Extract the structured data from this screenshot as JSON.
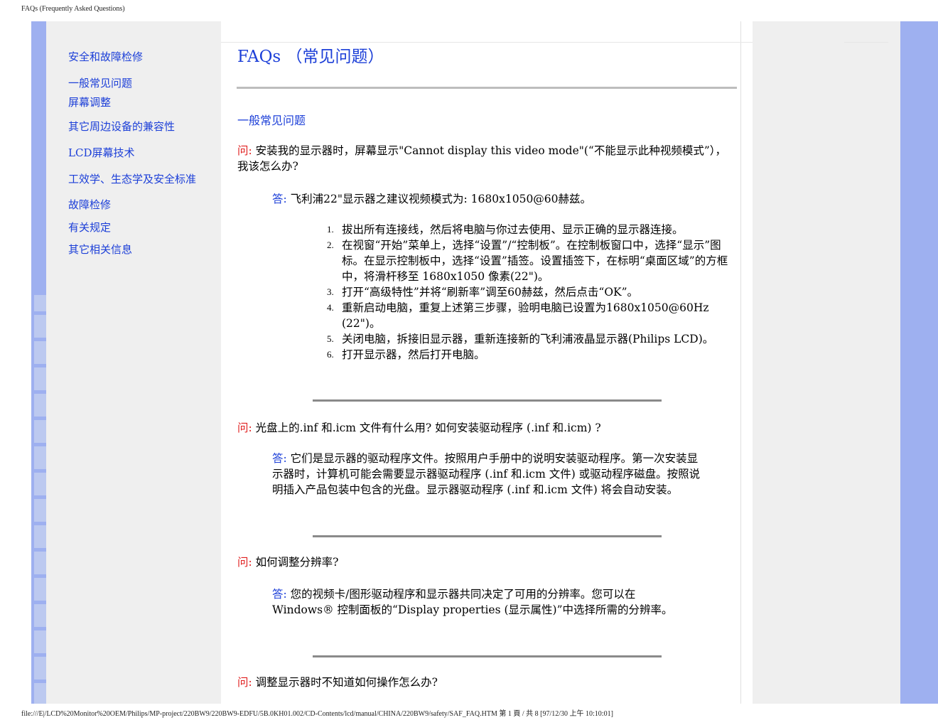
{
  "page_header": "FAQs (Frequently Asked Questions)",
  "page_footer": "file:///E|/LCD%20Monitor%20OEM/Philips/MP-project/220BW9/220BW9-EDFU/5B.0KH01.002/CD-Contents/lcd/manual/CHINA/220BW9/safety/SAF_FAQ.HTM 第 1 頁 / 共 8  [97/12/30 上午 10:10:01]",
  "sidebar": {
    "items": [
      {
        "label": "安全和故障检修"
      },
      {
        "label": "一般常见问题"
      },
      {
        "label": "屏幕调整"
      },
      {
        "label": "其它周边设备的兼容性"
      },
      {
        "label": "LCD屏幕技术"
      },
      {
        "label": "工效学、生态学及安全标准"
      },
      {
        "label": "故障检修"
      },
      {
        "label": "有关规定"
      },
      {
        "label": "其它相关信息"
      }
    ]
  },
  "main": {
    "title": "FAQs （常见问题）",
    "section_title": "一般常见问题",
    "q_label": "问:",
    "a_label": "答:",
    "faqs": [
      {
        "question": "安装我的显示器时，屏幕显示\"Cannot display this video mode\"(“不能显示此种视频模式”），我该怎么办?",
        "answer": "飞利浦22\"显示器之建议视频模式为: 1680x1050@60赫兹。",
        "steps": [
          "拔出所有连接线，然后将电脑与你过去使用、显示正确的显示器连接。",
          "在视窗“开始”菜单上，选择“设置”/“控制板”。在控制板窗口中，选择“显示”图标。在显示控制板中，选择“设置”插签。设置插签下，在标明“桌面区域”的方框中，将滑杆移至 1680x1050 像素(22\")。",
          "打开“高级特性”并将“刷新率”调至60赫兹，然后点击“OK”。",
          "重新启动电脑，重复上述第三步骤，验明电脑已设置为1680x1050@60Hz (22\")。",
          "关闭电脑，拆接旧显示器，重新连接新的飞利浦液晶显示器(Philips LCD)。",
          "打开显示器，然后打开电脑。"
        ]
      },
      {
        "question": "光盘上的.inf 和.icm 文件有什么用? 如何安装驱动程序 (.inf 和.icm) ?",
        "answer": "它们是显示器的驱动程序文件。按照用户手册中的说明安装驱动程序。第一次安装显示器时，计算机可能会需要显示器驱动程序 (.inf 和.icm 文件) 或驱动程序磁盘。按照说明插入产品包装中包含的光盘。显示器驱动程序 (.inf 和.icm 文件) 将会自动安装。"
      },
      {
        "question": "如何调整分辨率?",
        "answer": "您的视频卡/图形驱动程序和显示器共同决定了可用的分辨率。您可以在Windows® 控制面板的“Display properties (显示属性)”中选择所需的分辨率。"
      },
      {
        "question": "调整显示器时不知道如何操作怎么办?"
      }
    ]
  }
}
